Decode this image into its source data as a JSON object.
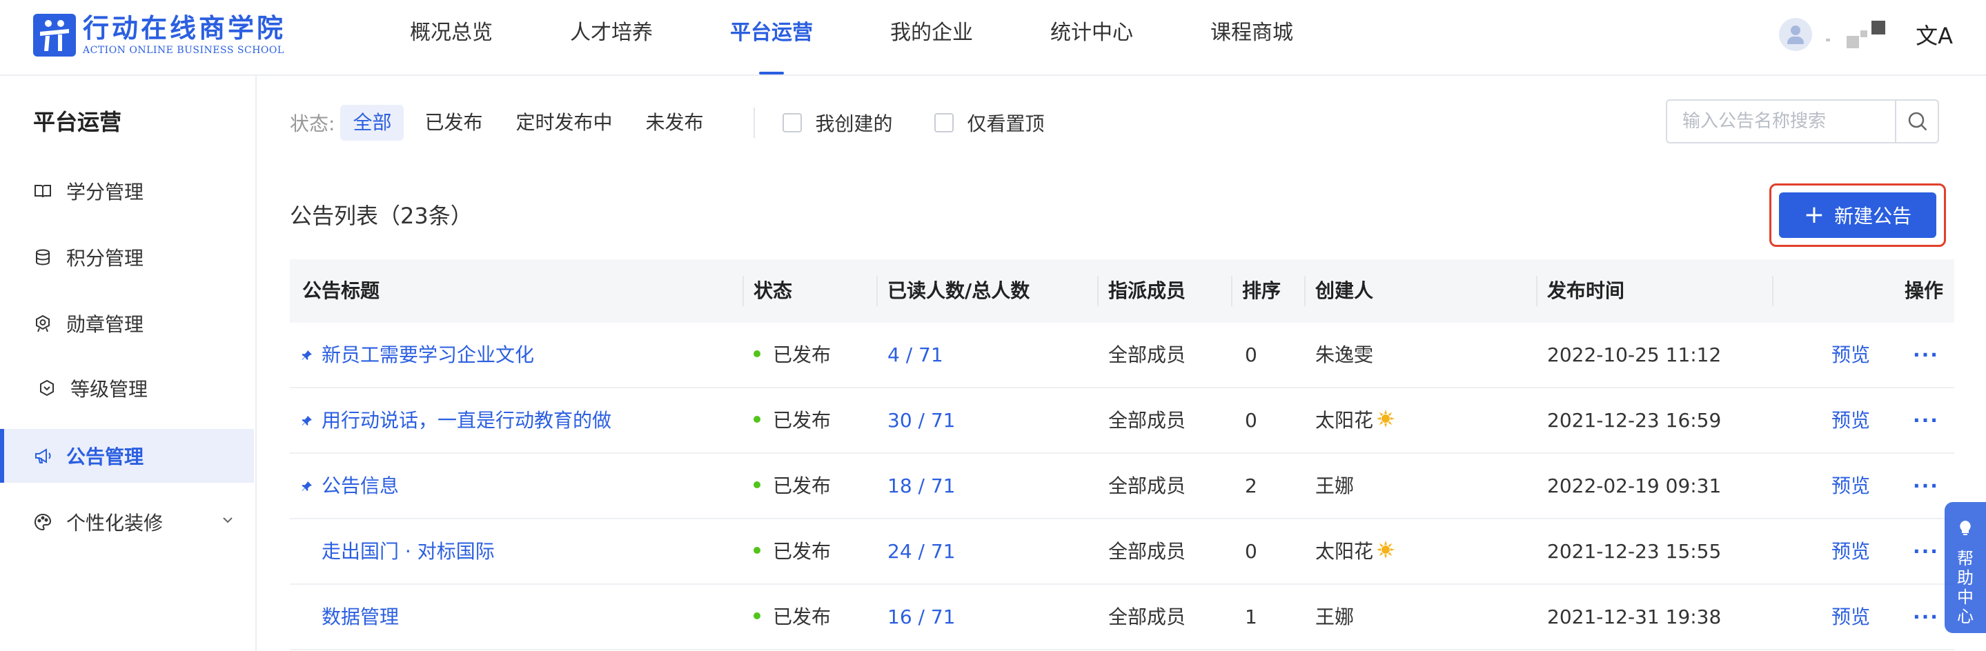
{
  "brand": {
    "name_cn": "行动在线商学院",
    "name_en": "ACTION ONLINE BUSINESS SCHOOL",
    "color": "#2b5fe0"
  },
  "nav": {
    "items": [
      {
        "label": "概况总览",
        "active": false
      },
      {
        "label": "人才培养",
        "active": false
      },
      {
        "label": "平台运营",
        "active": true
      },
      {
        "label": "我的企业",
        "active": false
      },
      {
        "label": "统计中心",
        "active": false
      },
      {
        "label": "课程商城",
        "active": false
      }
    ]
  },
  "user": {
    "avatar_icon": "user-avatar-icon",
    "language_icon": "translate-icon",
    "language_glyph": "文A"
  },
  "sidebar": {
    "title": "平台运营",
    "items": [
      {
        "label": "学分管理",
        "icon": "book-icon"
      },
      {
        "label": "积分管理",
        "icon": "database-icon"
      },
      {
        "label": "勋章管理",
        "icon": "medal-icon"
      },
      {
        "label": "等级管理",
        "icon": "level-icon"
      },
      {
        "label": "公告管理",
        "icon": "megaphone-icon"
      },
      {
        "label": "个性化装修",
        "icon": "palette-icon"
      }
    ],
    "active_index": 4
  },
  "filters": {
    "status_label": "状态:",
    "status_options": [
      "全部",
      "已发布",
      "定时发布中",
      "未发布"
    ],
    "active_status": "全部",
    "checkboxes": [
      "我创建的",
      "仅看置顶"
    ]
  },
  "search": {
    "placeholder": "输入公告名称搜索",
    "value": ""
  },
  "list": {
    "title": "公告列表（23条）",
    "new_button": "新建公告"
  },
  "table": {
    "columns": [
      "公告标题",
      "状态",
      "已读人数/总人数",
      "指派成员",
      "排序",
      "创建人",
      "发布时间",
      "操作"
    ],
    "rows": [
      {
        "pinned": true,
        "title": "新员工需要学习企业文化",
        "status": "已发布",
        "read": "4 / 71",
        "assigned": "全部成员",
        "order": "0",
        "creator": "朱逸雯",
        "sun": false,
        "published": "2022-10-25 11:12",
        "action": "预览",
        "more": "···"
      },
      {
        "pinned": true,
        "title": "用行动说话，一直是行动教育的做",
        "status": "已发布",
        "read": "30 / 71",
        "assigned": "全部成员",
        "order": "0",
        "creator": "太阳花",
        "sun": true,
        "published": "2021-12-23 16:59",
        "action": "预览",
        "more": "···"
      },
      {
        "pinned": true,
        "title": "公告信息",
        "status": "已发布",
        "read": "18 / 71",
        "assigned": "全部成员",
        "order": "2",
        "creator": "王娜",
        "sun": false,
        "published": "2022-02-19 09:31",
        "action": "预览",
        "more": "···"
      },
      {
        "pinned": false,
        "title": "走出国门 · 对标国际",
        "status": "已发布",
        "read": "24 / 71",
        "assigned": "全部成员",
        "order": "0",
        "creator": "太阳花",
        "sun": true,
        "published": "2021-12-23 15:55",
        "action": "预览",
        "more": "···"
      },
      {
        "pinned": false,
        "title": "数据管理",
        "status": "已发布",
        "read": "16 / 71",
        "assigned": "全部成员",
        "order": "1",
        "creator": "王娜",
        "sun": false,
        "published": "2021-12-31 19:38",
        "action": "预览",
        "more": "···"
      }
    ]
  },
  "help": {
    "label": "帮助中心",
    "icon": "lightbulb-icon"
  }
}
